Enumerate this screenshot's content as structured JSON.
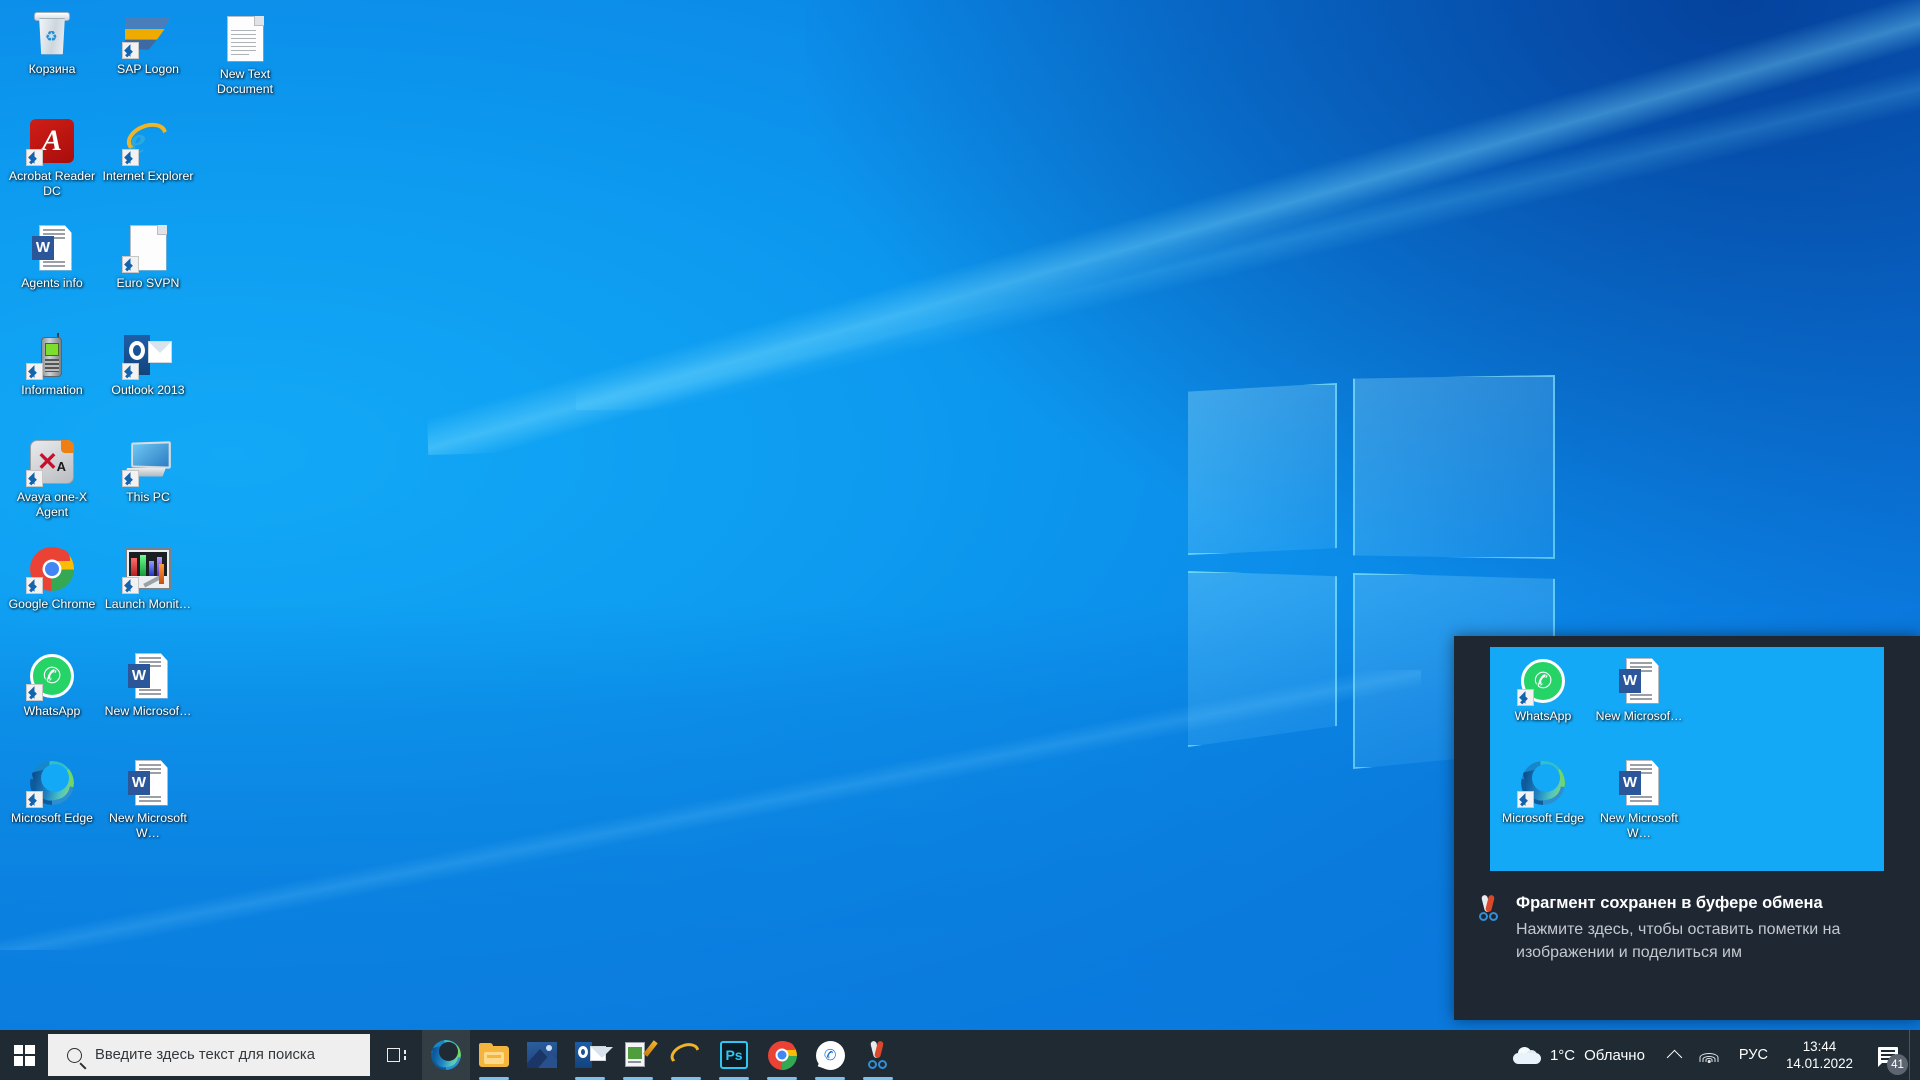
{
  "desktop": {
    "icons": [
      {
        "label": "Корзина",
        "icon": "recycle-bin-icon",
        "shortcut": false
      },
      {
        "label": "SAP Logon",
        "icon": "sap-logon-icon",
        "shortcut": true
      },
      {
        "label": "New Text Document",
        "icon": "text-document-icon",
        "shortcut": false
      },
      {
        "label": "Acrobat Reader DC",
        "icon": "acrobat-reader-icon",
        "shortcut": true
      },
      {
        "label": "Internet Explorer",
        "icon": "internet-explorer-icon",
        "shortcut": true
      },
      {
        "label": "Agents info",
        "icon": "word-document-icon",
        "shortcut": false
      },
      {
        "label": "Euro SVPN",
        "icon": "blank-document-icon",
        "shortcut": true
      },
      {
        "label": "Information",
        "icon": "mobile-phone-icon",
        "shortcut": true
      },
      {
        "label": "Outlook 2013",
        "icon": "outlook-icon",
        "shortcut": true
      },
      {
        "label": "Avaya one-X Agent",
        "icon": "avaya-one-x-icon",
        "shortcut": true
      },
      {
        "label": "This PC",
        "icon": "this-pc-icon",
        "shortcut": true
      },
      {
        "label": "Google Chrome",
        "icon": "google-chrome-icon",
        "shortcut": true
      },
      {
        "label": "Launch Monit…",
        "icon": "launch-monitor-icon",
        "shortcut": true
      },
      {
        "label": "WhatsApp",
        "icon": "whatsapp-icon",
        "shortcut": true
      },
      {
        "label": "New Microsof…",
        "icon": "word-document-icon",
        "shortcut": false
      },
      {
        "label": "Microsoft Edge",
        "icon": "microsoft-edge-icon",
        "shortcut": true
      },
      {
        "label": "New Microsoft W…",
        "icon": "word-document-icon",
        "shortcut": false
      }
    ]
  },
  "toast": {
    "title": "Фрагмент сохранен в буфере обмена",
    "message": "Нажмите здесь, чтобы оставить пометки на изображении и поделиться им",
    "app_icon": "snip-and-sketch-icon",
    "preview_icons": [
      {
        "label": "WhatsApp",
        "icon": "whatsapp-icon",
        "shortcut": true
      },
      {
        "label": "New Microsof…",
        "icon": "word-document-icon",
        "shortcut": false
      },
      {
        "label": "Microsoft Edge",
        "icon": "microsoft-edge-icon",
        "shortcut": true
      },
      {
        "label": "New Microsoft W…",
        "icon": "word-document-icon",
        "shortcut": false
      }
    ]
  },
  "taskbar": {
    "start_icon": "windows-start-icon",
    "search": {
      "placeholder": "Введите здесь текст для поиска",
      "icon": "search-icon"
    },
    "task_view_icon": "task-view-icon",
    "apps": [
      {
        "name": "microsoft-edge",
        "icon": "microsoft-edge-icon",
        "active": true,
        "running": false
      },
      {
        "name": "file-explorer",
        "icon": "file-explorer-icon",
        "active": false,
        "running": true
      },
      {
        "name": "photos",
        "icon": "photos-icon",
        "active": false,
        "running": false
      },
      {
        "name": "outlook",
        "icon": "outlook-icon",
        "active": false,
        "running": true
      },
      {
        "name": "sticky-notes",
        "icon": "notes-pen-icon",
        "active": false,
        "running": true
      },
      {
        "name": "internet-explorer",
        "icon": "internet-explorer-icon",
        "active": false,
        "running": true
      },
      {
        "name": "photoshop",
        "icon": "photoshop-icon",
        "active": false,
        "running": true
      },
      {
        "name": "google-chrome",
        "icon": "google-chrome-icon",
        "active": false,
        "running": true
      },
      {
        "name": "whatsapp",
        "icon": "whatsapp-taskbar-icon",
        "active": false,
        "running": true
      },
      {
        "name": "snip-and-sketch",
        "icon": "snip-and-sketch-icon",
        "active": false,
        "running": true
      }
    ],
    "tray": {
      "weather": {
        "icon": "cloud-icon",
        "temperature": "1°C",
        "condition": "Облачно"
      },
      "show_hidden_icons": "chevron-up-icon",
      "network_icon": "wifi-icon",
      "language": "РУС",
      "clock": {
        "time": "13:44",
        "date": "14.01.2022"
      },
      "action_center": {
        "icon": "action-center-icon",
        "badge": "41"
      },
      "show_desktop": "show-desktop-button"
    }
  },
  "colors": {
    "taskbar": "#1f2a32",
    "accent": "#0078d7",
    "wallpaper_blue": "#13a9f7",
    "toast_bg": "#1f2733",
    "indicator": "#7cc0f0"
  }
}
